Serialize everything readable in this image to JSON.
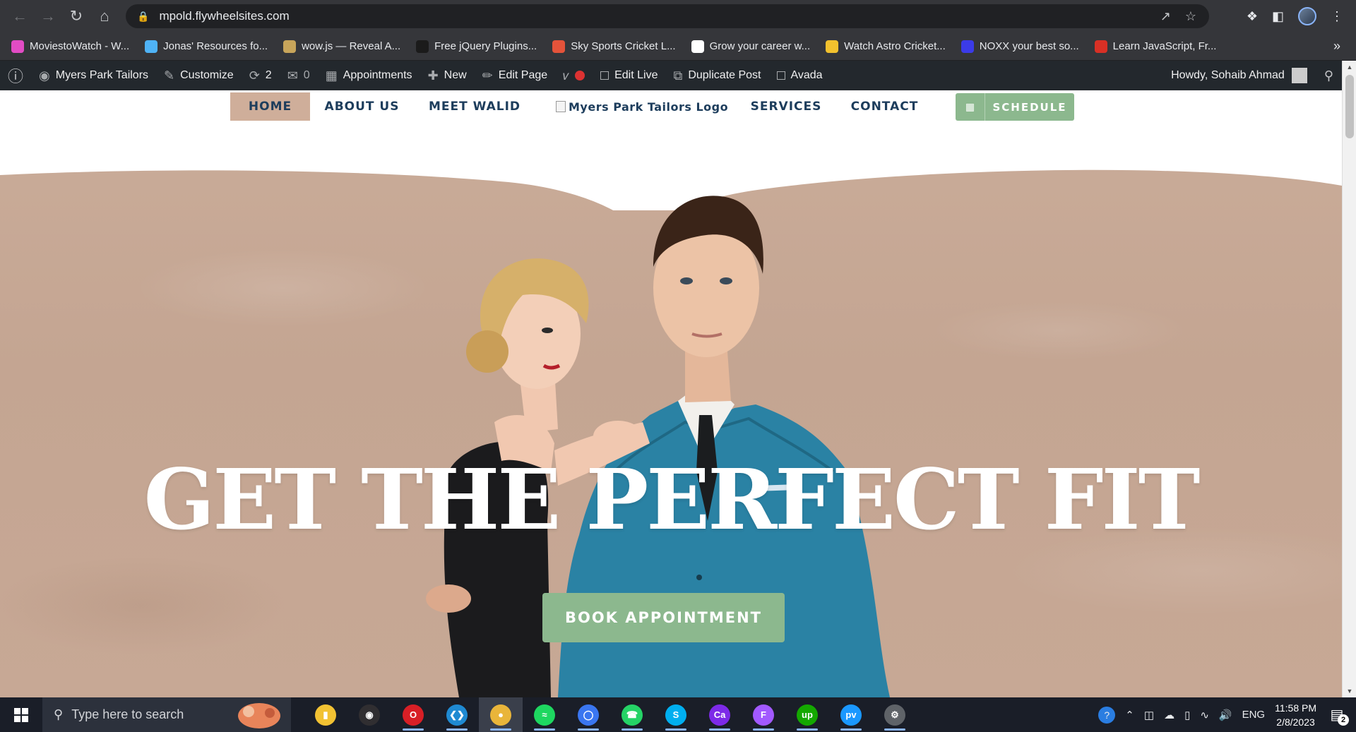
{
  "browser": {
    "url": "mpold.flywheelsites.com",
    "bookmarks": [
      {
        "label": "MoviestoWatch - W...",
        "color": "#e24cc4"
      },
      {
        "label": "Jonas' Resources fo...",
        "color": "#4fb3f6"
      },
      {
        "label": "wow.js — Reveal A...",
        "color": "#c8a55a"
      },
      {
        "label": "Free jQuery Plugins...",
        "color": "#1b1b1b"
      },
      {
        "label": "Sky Sports Cricket L...",
        "color": "#e5533a"
      },
      {
        "label": "Grow your career w...",
        "color": "#ffffff"
      },
      {
        "label": "Watch Astro Cricket...",
        "color": "#f2c12e"
      },
      {
        "label": "NOXX your best so...",
        "color": "#3b3be8"
      },
      {
        "label": "Learn JavaScript, Fr...",
        "color": "#d93025"
      }
    ],
    "more_label": "»"
  },
  "wp_admin_bar": {
    "site_name": "Myers Park Tailors",
    "customize": "Customize",
    "updates_count": "2",
    "comments_count": "0",
    "appointments": "Appointments",
    "new": "New",
    "edit_page": "Edit Page",
    "edit_live": "Edit Live",
    "duplicate_post": "Duplicate Post",
    "avada": "Avada",
    "howdy": "Howdy, Sohaib Ahmad"
  },
  "site_nav": {
    "home": "HOME",
    "about": "ABOUT US",
    "meet": "MEET WALID",
    "logo_alt": "Myers Park Tailors Logo",
    "services": "SERVICES",
    "contact": "CONTACT",
    "schedule": "SCHEDULE"
  },
  "hero": {
    "headline": "GET THE PERFECT FIT",
    "cta": "BOOK APPOINTMENT"
  },
  "taskbar": {
    "search_placeholder": "Type here to search",
    "language": "ENG",
    "time": "11:58 PM",
    "date": "2/8/2023",
    "notification_count": "2",
    "apps": [
      "file-explorer",
      "obs",
      "opera",
      "vscode",
      "chrome",
      "spotify",
      "signal",
      "whatsapp",
      "skype",
      "canva",
      "figma",
      "upwork",
      "prime-video",
      "settings"
    ]
  },
  "colors": {
    "accent_green": "#8cb88e",
    "nav_text": "#1d3d5c",
    "hero_bg": "#c9ab98",
    "wp_bar": "#23282d"
  }
}
